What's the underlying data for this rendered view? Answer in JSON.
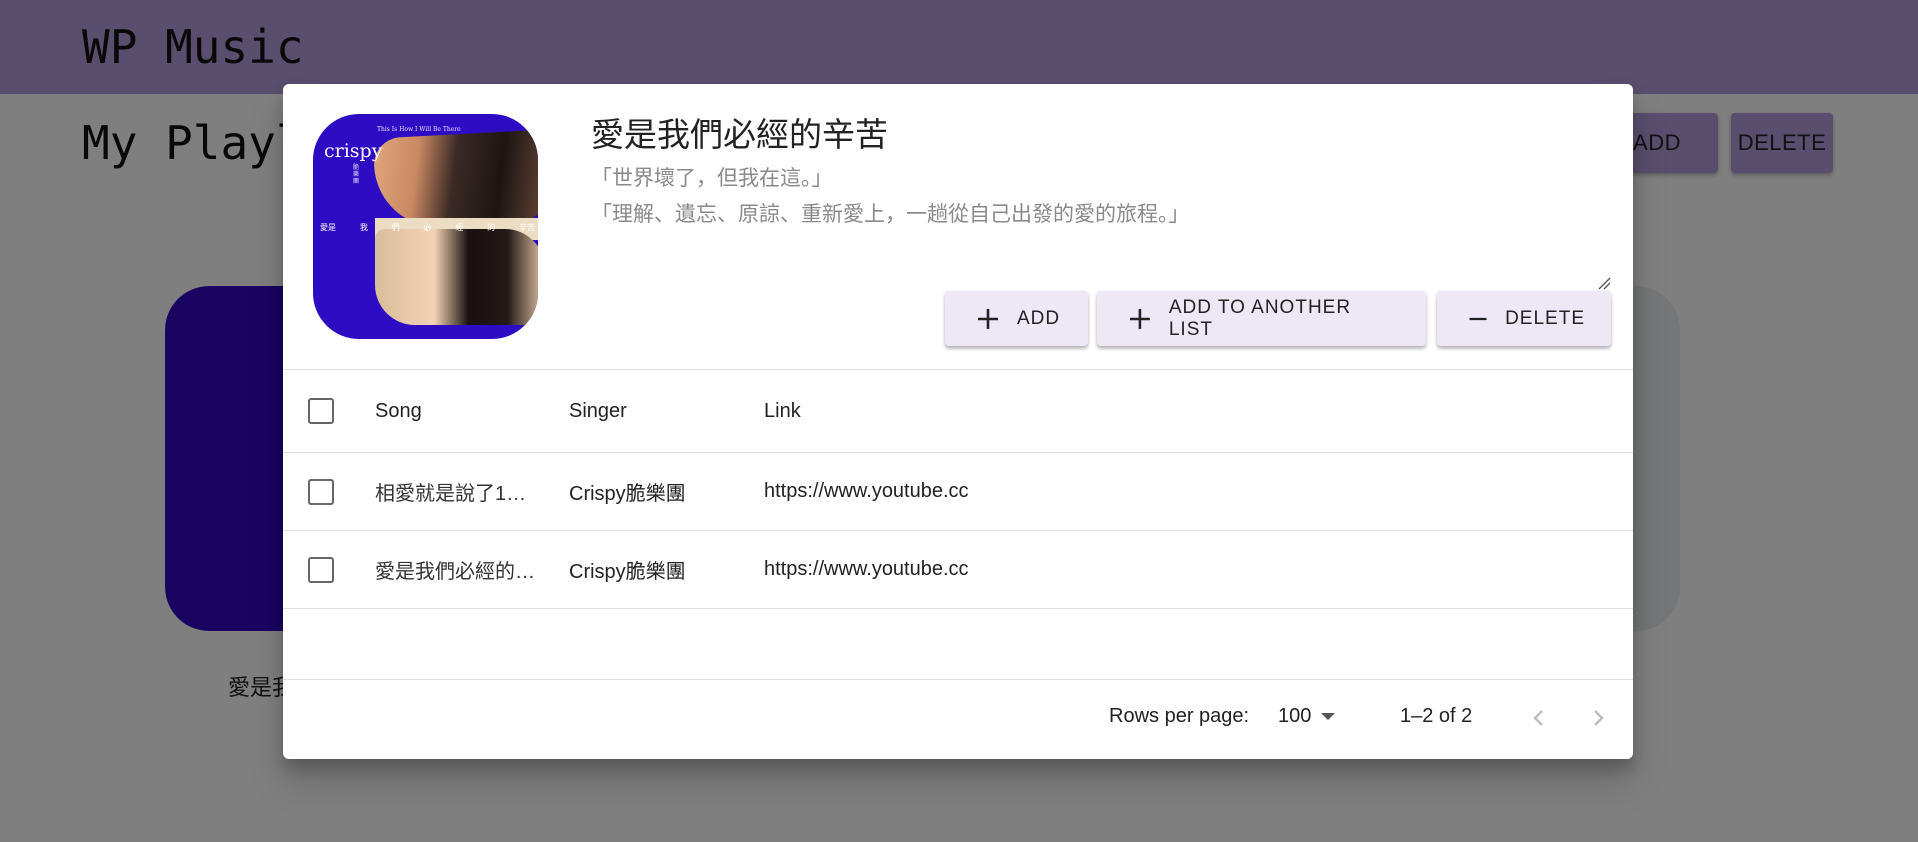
{
  "app": {
    "title": "WP Music"
  },
  "page": {
    "heading": "My Playlist",
    "add_label": "ADD",
    "delete_label": "DELETE",
    "card_label": "愛是我們必經的辛苦"
  },
  "dialog": {
    "album": {
      "title": "愛是我們必經的辛苦",
      "description": "「世界壞了，但我在這。」\n「理解、遺忘、原諒、重新愛上，一趟從自己出發的愛的旅程。」",
      "cover": {
        "tagline": "This Is How I Will Be There",
        "brand": "crispy",
        "vertical_text": "脆樂團",
        "strip_words": [
          "愛是",
          "我",
          "們",
          "必",
          "經",
          "的",
          "辛苦"
        ]
      }
    },
    "actions": {
      "add": "ADD",
      "add_to_another_list": "ADD TO ANOTHER LIST",
      "delete": "DELETE"
    },
    "table": {
      "columns": [
        "Song",
        "Singer",
        "Link"
      ],
      "rows": [
        {
          "song": "相愛就是說了1…",
          "singer": "Crispy脆樂團",
          "link": "https://www.youtube.cc"
        },
        {
          "song": "愛是我們必經的…",
          "singer": "Crispy脆樂團",
          "link": "https://www.youtube.cc"
        }
      ]
    },
    "pagination": {
      "rows_per_page_label": "Rows per page:",
      "rows_per_page_value": "100",
      "range": "1–2 of 2"
    }
  },
  "icons": {
    "add": "plus-icon",
    "delete": "minus-icon",
    "prev": "chevron-left-icon",
    "next": "chevron-right-icon",
    "dropdown": "caret-down-icon"
  },
  "colors": {
    "appbar": "#b39ddb",
    "button_bg": "#ede7f6",
    "cover_blue": "#2e0cc4"
  }
}
